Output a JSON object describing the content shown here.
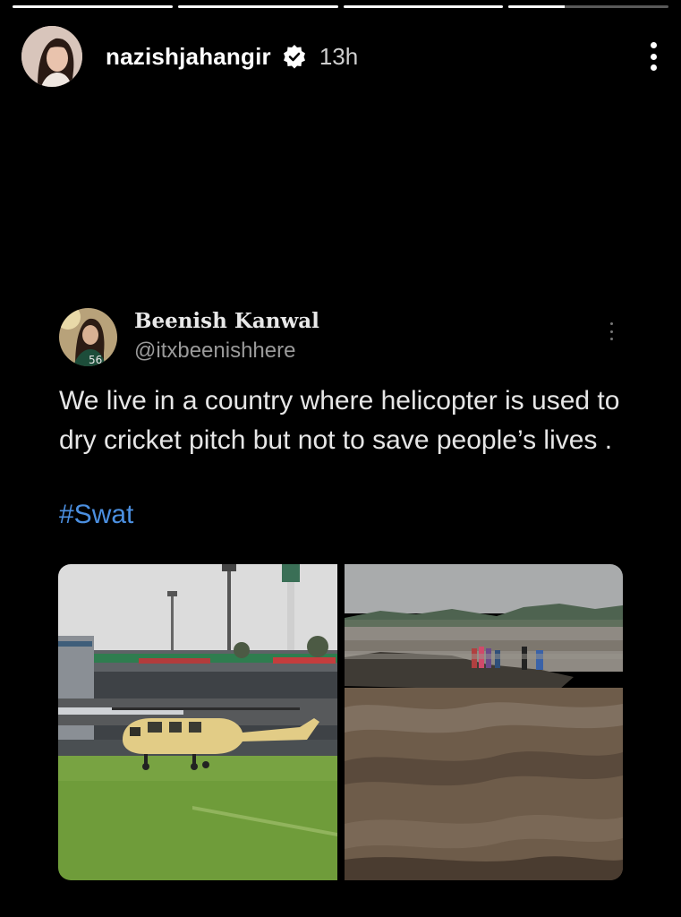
{
  "story": {
    "progress": [
      1,
      1,
      1,
      0.35
    ],
    "username": "nazishjahangir",
    "time": "13h",
    "icons": {
      "verified": "verified-badge-icon",
      "more": "more-vertical-icon"
    }
  },
  "tweet": {
    "display_name": "Beenish Kanwal",
    "handle": "@itxbeenishhere",
    "text": "We live in a country where helicopter is used to dry cricket pitch but not to save people’s lives .",
    "hashtag": "#Swat",
    "colors": {
      "hashtag": "#4b8fe0",
      "handle": "#9a9a9a"
    }
  }
}
